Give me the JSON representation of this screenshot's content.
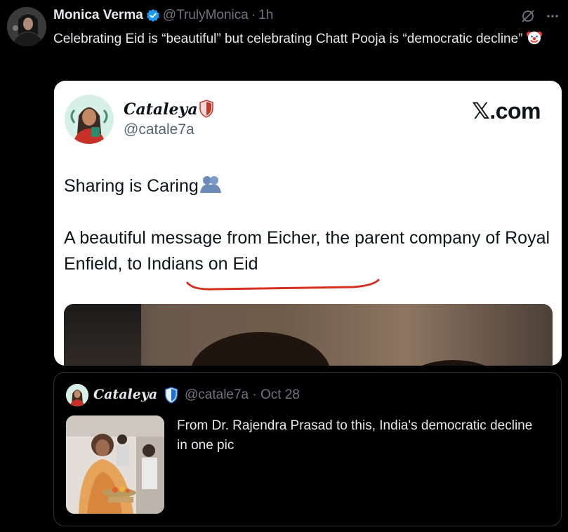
{
  "post": {
    "author_name": "Monica Verma",
    "handle": "@TrulyMonica",
    "separator": "·",
    "time": "1h",
    "text": "Celebrating Eid is “beautiful” but celebrating Chatt Pooja is “democratic decline”",
    "emoji": "clown-face-icon"
  },
  "embedded_screenshot": {
    "author_name": "Cataleya",
    "handle": "@catale7a",
    "site": "𝕏.com",
    "line1": "Sharing is Caring",
    "line2": "A beautiful message from Eicher, the parent company of Royal Enfield, to Indians on Eid"
  },
  "quote": {
    "author_name": "Cataleya",
    "handle": "@catale7a",
    "separator": "·",
    "date": "Oct 28",
    "text": "From Dr. Rajendra Prasad to this, India's democratic decline in one pic"
  },
  "colors": {
    "background": "#000000",
    "text_primary": "#e7e9ea",
    "text_secondary": "#71767b",
    "verified_blue": "#1d9bf0",
    "border": "#2f3336",
    "underline_red": "#d4301f"
  }
}
